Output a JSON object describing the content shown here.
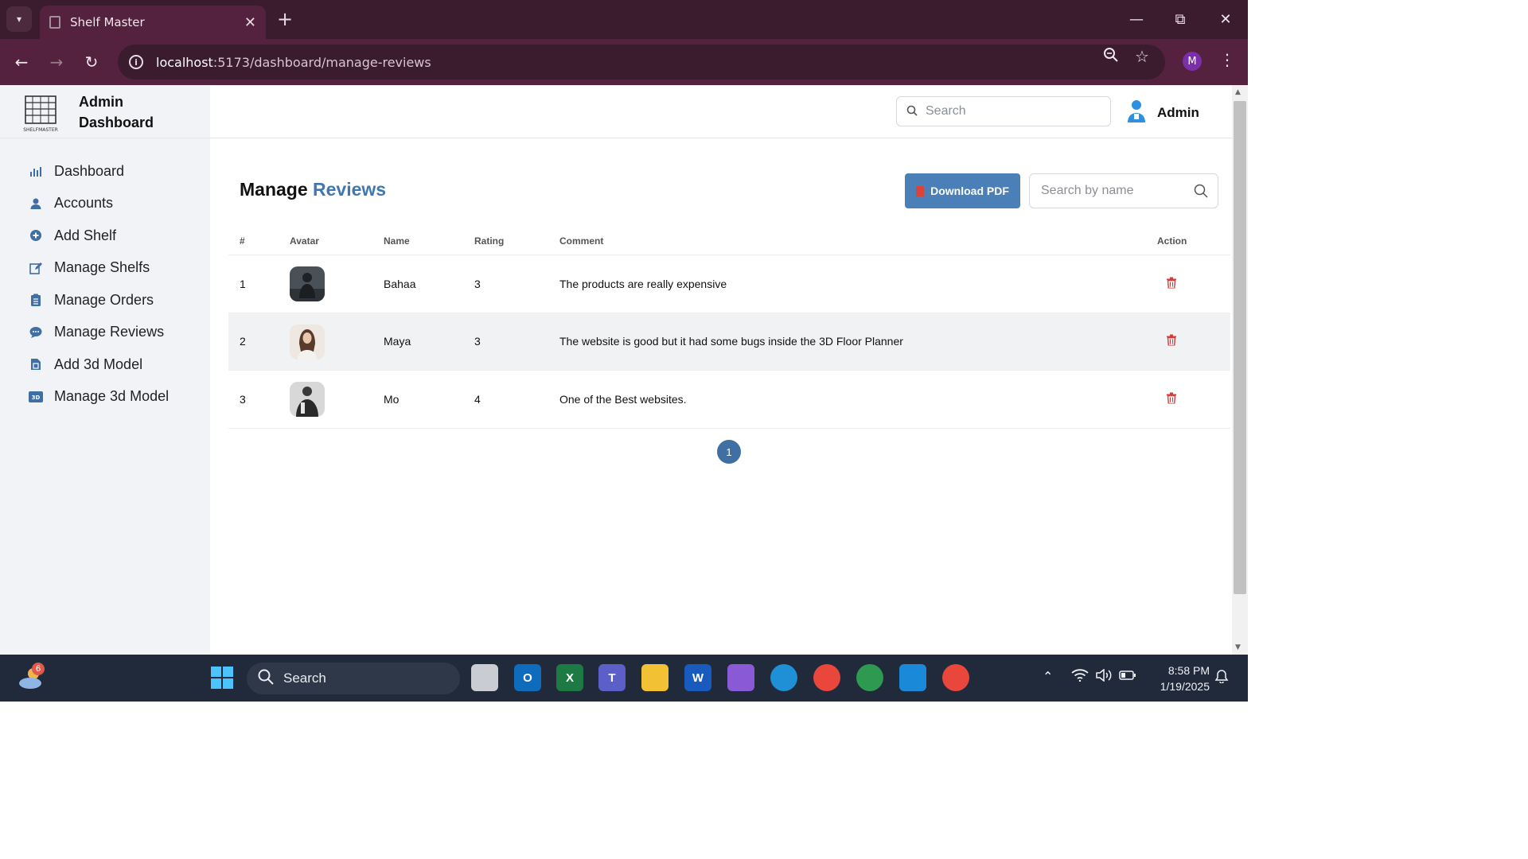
{
  "browser": {
    "tab_title": "Shelf Master",
    "url_host": "localhost",
    "url_path": ":5173/dashboard/manage-reviews",
    "profile_initial": "M"
  },
  "app": {
    "brand_title": "Admin Dashboard",
    "logo_caption": "SHELFMASTER",
    "search_placeholder": "Search",
    "user_label": "Admin",
    "accent": "#3f77b0",
    "sidebar": [
      {
        "label": "Dashboard",
        "icon": "bar-chart-icon"
      },
      {
        "label": "Accounts",
        "icon": "user-icon"
      },
      {
        "label": "Add Shelf",
        "icon": "plus-circle-icon"
      },
      {
        "label": "Manage Shelfs",
        "icon": "edit-icon"
      },
      {
        "label": "Manage Orders",
        "icon": "clipboard-icon"
      },
      {
        "label": "Manage Reviews",
        "icon": "comment-icon"
      },
      {
        "label": "Add 3d Model",
        "icon": "file-icon"
      },
      {
        "label": "Manage 3d Model",
        "icon": "3d-icon"
      }
    ]
  },
  "page": {
    "title_part1": "Manage",
    "title_part2": "Reviews",
    "download_label": "Download PDF",
    "name_search_placeholder": "Search by name",
    "columns": [
      "#",
      "Avatar",
      "Name",
      "Rating",
      "Comment",
      "Action"
    ],
    "rows": [
      {
        "num": "1",
        "name": "Bahaa",
        "rating": "3",
        "comment": "The products are really expensive"
      },
      {
        "num": "2",
        "name": "Maya",
        "rating": "3",
        "comment": "The website is good but it had some bugs inside the 3D Floor Planner"
      },
      {
        "num": "3",
        "name": "Mo",
        "rating": "4",
        "comment": "One of the Best websites."
      }
    ],
    "current_page": "1"
  },
  "taskbar": {
    "search_label": "Search",
    "weather_badge": "6",
    "time": "8:58 PM",
    "date": "1/19/2025"
  }
}
